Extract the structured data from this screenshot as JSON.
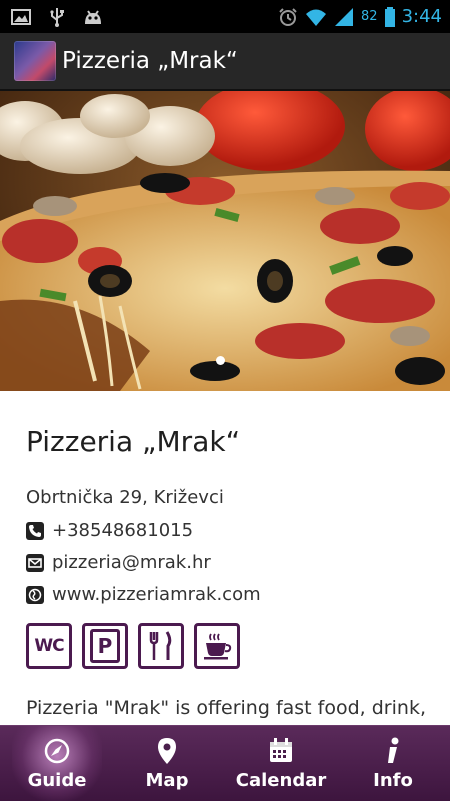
{
  "status_bar": {
    "time": "3:44",
    "battery": "82",
    "left_icons": [
      "image-notification-icon",
      "usb-icon",
      "android-debug-icon"
    ],
    "right_icons": [
      "alarm-icon",
      "wifi-icon",
      "signal-icon",
      "battery-icon"
    ],
    "accent_color": "#33b5e5"
  },
  "action_bar": {
    "title": "Pizzeria „Mrak“",
    "background": "#272727"
  },
  "hero": {
    "image": "pizza-photo",
    "page_indicator_active": 1
  },
  "place": {
    "name": "Pizzeria „Mrak“",
    "address": "Obrtnička 29, Križevci",
    "phone": "+38548681015",
    "email": "pizzeria@mrak.hr",
    "website": "www.pizzeriamrak.com",
    "amenities": [
      {
        "icon": "wc-icon",
        "label": "WC"
      },
      {
        "icon": "parking-icon",
        "label": "P"
      },
      {
        "icon": "restaurant-icon"
      },
      {
        "icon": "coffee-icon"
      }
    ],
    "description": "Pizzeria \"Mrak\" is offering fast food, drink,"
  },
  "tab_bar": {
    "tabs": [
      {
        "label": "Guide",
        "icon": "compass-icon",
        "active": true
      },
      {
        "label": "Map",
        "icon": "map-pin-icon",
        "active": false
      },
      {
        "label": "Calendar",
        "icon": "calendar-icon",
        "active": false
      },
      {
        "label": "Info",
        "icon": "info-icon",
        "active": false
      }
    ],
    "background": "#4a1f4b"
  }
}
